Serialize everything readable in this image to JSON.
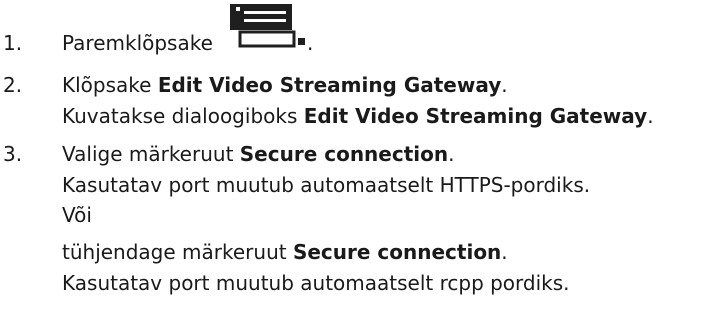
{
  "icon": {
    "name": "video-gateway-device-icon",
    "color": "#1f1f1f"
  },
  "steps": [
    {
      "number": "1.",
      "text": "Paremklõpsake",
      "after_icon": "."
    },
    {
      "number": "2.",
      "prefix": "Klõpsake ",
      "bold": "Edit Video Streaming Gateway",
      "suffix": ".",
      "sub": [
        {
          "prefix": "Kuvatakse dialoogiboks ",
          "bold": "Edit Video Streaming Gateway",
          "suffix": "."
        }
      ]
    },
    {
      "number": "3.",
      "prefix": "Valige märkeruut ",
      "bold": "Secure connection",
      "suffix": ".",
      "sub": [
        {
          "text": "Kasutatav port muutub automaatselt HTTPS-pordiks."
        },
        {
          "text": "Või"
        },
        {
          "prefix": "tühjendage märkeruut ",
          "bold": "Secure connection",
          "suffix": "."
        },
        {
          "text": "Kasutatav port muutub automaatselt rcpp pordiks."
        }
      ]
    }
  ]
}
